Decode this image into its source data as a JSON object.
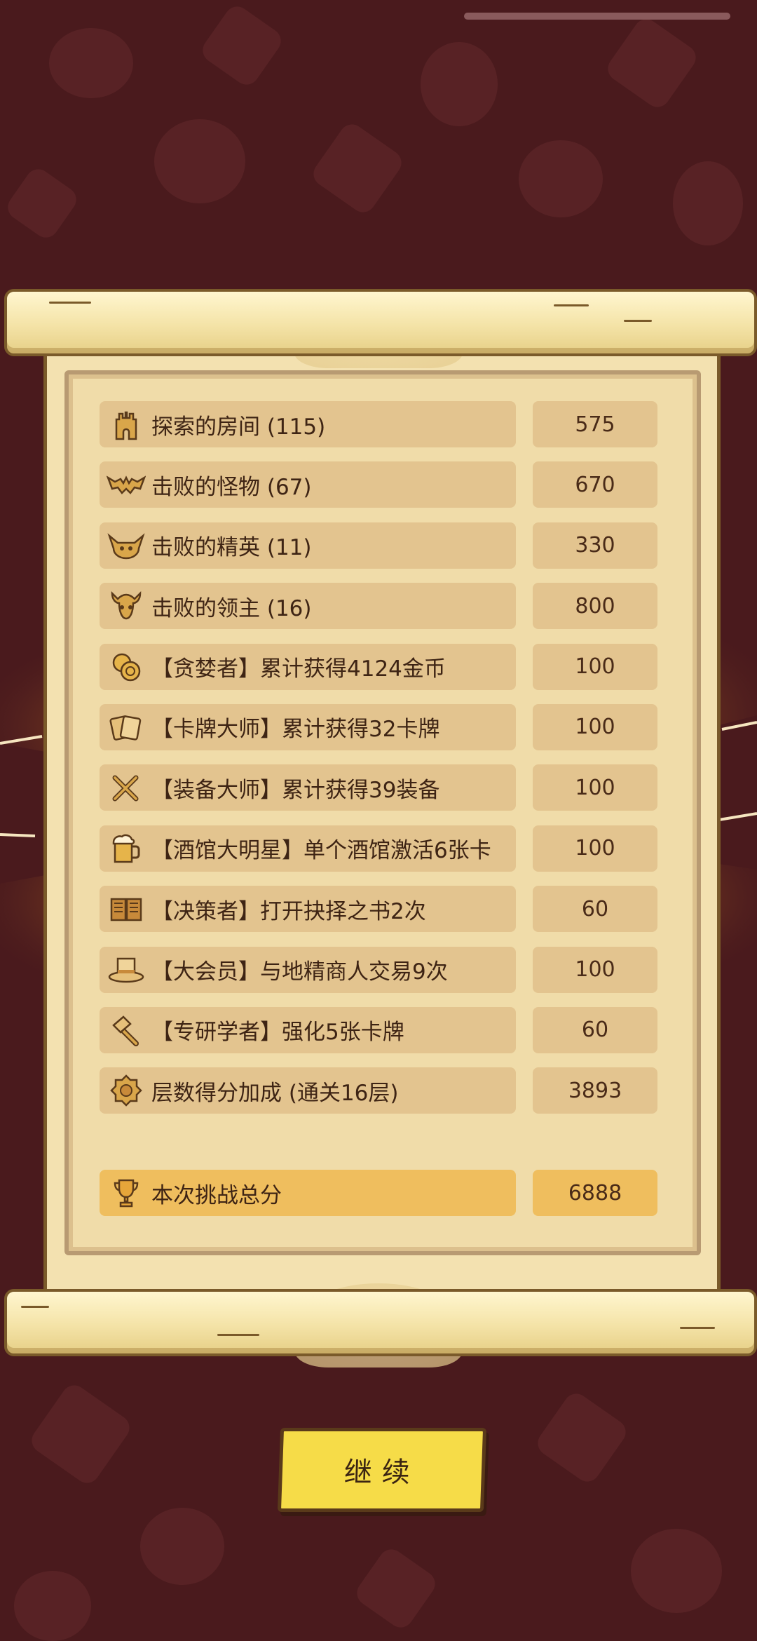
{
  "rows": [
    {
      "icon": "tower-icon",
      "label": "探索的房间 (115)",
      "value": "575"
    },
    {
      "icon": "bat-icon",
      "label": "击败的怪物 (67)",
      "value": "670"
    },
    {
      "icon": "demon-icon",
      "label": "击败的精英 (11)",
      "value": "330"
    },
    {
      "icon": "horned-skull-icon",
      "label": "击败的领主 (16)",
      "value": "800"
    },
    {
      "icon": "coins-icon",
      "label": "【贪婪者】累计获得4124金币",
      "value": "100"
    },
    {
      "icon": "cards-icon",
      "label": "【卡牌大师】累计获得32卡牌",
      "value": "100"
    },
    {
      "icon": "crossed-tools-icon",
      "label": "【装备大师】累计获得39装备",
      "value": "100"
    },
    {
      "icon": "beer-mug-icon",
      "label": "【酒馆大明星】单个酒馆激活6张卡",
      "value": "100"
    },
    {
      "icon": "book-icon",
      "label": "【决策者】打开抉择之书2次",
      "value": "60"
    },
    {
      "icon": "top-hat-icon",
      "label": "【大会员】与地精商人交易9次",
      "value": "100"
    },
    {
      "icon": "hammer-icon",
      "label": "【专研学者】强化5张卡牌",
      "value": "60"
    },
    {
      "icon": "floor-badge-icon",
      "label": "层数得分加成 (通关16层)",
      "value": "3893"
    }
  ],
  "total": {
    "icon": "trophy-icon",
    "label": "本次挑战总分",
    "value": "6888"
  },
  "continue_label": "继续",
  "colors": {
    "background": "#4a1a1d",
    "paper": "#f3e1b0",
    "row": "#e3c48f",
    "total_row": "#efbe5e",
    "button": "#f6dc48"
  }
}
